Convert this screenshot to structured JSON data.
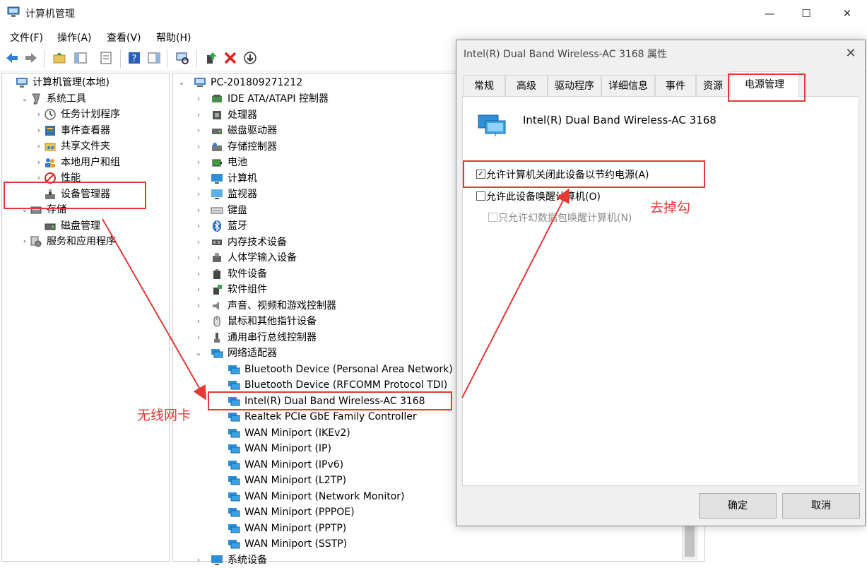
{
  "window": {
    "title": "计算机管理",
    "minimize": "—",
    "maximize": "☐",
    "close": "✕"
  },
  "menu": [
    "文件(F)",
    "操作(A)",
    "查看(V)",
    "帮助(H)"
  ],
  "left_tree": [
    {
      "label": "计算机管理(本地)",
      "indent": 0,
      "chevron": "",
      "icon": "computer-management-icon"
    },
    {
      "label": "系统工具",
      "indent": 1,
      "chevron": "⌄",
      "icon": "tools-icon"
    },
    {
      "label": "任务计划程序",
      "indent": 2,
      "chevron": "›",
      "icon": "clock-icon"
    },
    {
      "label": "事件查看器",
      "indent": 2,
      "chevron": "›",
      "icon": "event-viewer-icon"
    },
    {
      "label": "共享文件夹",
      "indent": 2,
      "chevron": "›",
      "icon": "shared-folder-icon"
    },
    {
      "label": "本地用户和组",
      "indent": 2,
      "chevron": "›",
      "icon": "users-icon"
    },
    {
      "label": "性能",
      "indent": 2,
      "chevron": "›",
      "icon": "performance-icon"
    },
    {
      "label": "设备管理器",
      "indent": 2,
      "chevron": "",
      "icon": "device-manager-icon"
    },
    {
      "label": "存储",
      "indent": 1,
      "chevron": "⌄",
      "icon": "storage-icon"
    },
    {
      "label": "磁盘管理",
      "indent": 2,
      "chevron": "",
      "icon": "disk-icon"
    },
    {
      "label": "服务和应用程序",
      "indent": 1,
      "chevron": "›",
      "icon": "services-icon"
    }
  ],
  "device_tree": {
    "root": "PC-201809271212",
    "categories": [
      {
        "label": "IDE ATA/ATAPI 控制器",
        "icon": "ide-controller-icon"
      },
      {
        "label": "处理器",
        "icon": "processor-icon"
      },
      {
        "label": "磁盘驱动器",
        "icon": "disk-drive-icon"
      },
      {
        "label": "存储控制器",
        "icon": "storage-controller-icon"
      },
      {
        "label": "电池",
        "icon": "battery-icon"
      },
      {
        "label": "计算机",
        "icon": "computer-icon"
      },
      {
        "label": "监视器",
        "icon": "monitor-icon"
      },
      {
        "label": "键盘",
        "icon": "keyboard-icon"
      },
      {
        "label": "蓝牙",
        "icon": "bluetooth-icon"
      },
      {
        "label": "内存技术设备",
        "icon": "memory-icon"
      },
      {
        "label": "人体学输入设备",
        "icon": "hid-icon"
      },
      {
        "label": "软件设备",
        "icon": "software-device-icon"
      },
      {
        "label": "软件组件",
        "icon": "software-component-icon"
      },
      {
        "label": "声音、视频和游戏控制器",
        "icon": "sound-icon"
      },
      {
        "label": "鼠标和其他指针设备",
        "icon": "mouse-icon"
      },
      {
        "label": "通用串行总线控制器",
        "icon": "usb-icon"
      },
      {
        "label": "网络适配器",
        "icon": "network-adapter-icon"
      }
    ],
    "network_adapters": [
      "Bluetooth Device (Personal Area Network)",
      "Bluetooth Device (RFCOMM Protocol TDI)",
      "Intel(R) Dual Band Wireless-AC 3168",
      "Realtek PCIe GbE Family Controller",
      "WAN Miniport (IKEv2)",
      "WAN Miniport (IP)",
      "WAN Miniport (IPv6)",
      "WAN Miniport (L2TP)",
      "WAN Miniport (Network Monitor)",
      "WAN Miniport (PPPOE)",
      "WAN Miniport (PPTP)",
      "WAN Miniport (SSTP)"
    ],
    "trailing_item": "系统设备"
  },
  "dialog": {
    "title": "Intel(R) Dual Band Wireless-AC 3168 属性",
    "close": "✕",
    "tabs": [
      "常规",
      "高级",
      "驱动程序",
      "详细信息",
      "事件",
      "资源",
      "电源管理"
    ],
    "device_name": "Intel(R) Dual Band Wireless-AC 3168",
    "options": [
      {
        "label": "允许计算机关闭此设备以节约电源(A)",
        "checked": true,
        "enabled": true
      },
      {
        "label": "允许此设备唤醒计算机(O)",
        "checked": false,
        "enabled": true
      },
      {
        "label": "只允许幻数据包唤醒计算机(N)",
        "checked": false,
        "enabled": false
      }
    ],
    "ok": "确定",
    "cancel": "取消"
  },
  "annotations": {
    "wireless_card": "无线网卡",
    "uncheck": "去掉勾"
  },
  "colors": {
    "annotation": "#e53935",
    "dialog_bg": "#f0f0f0"
  }
}
